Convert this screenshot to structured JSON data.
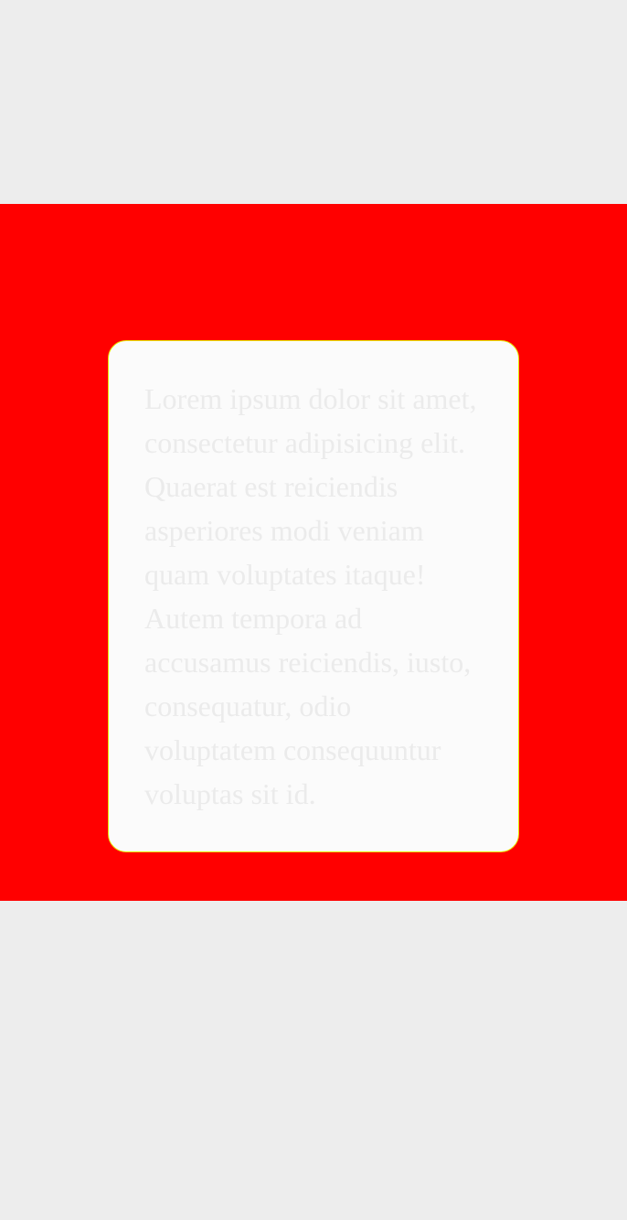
{
  "page": {
    "background_color": "#ededed",
    "band_color": "#ff0000",
    "card_background": "#fbfbfb",
    "card_border_color": "#e8e800",
    "text_color": "#ebebeb"
  },
  "card": {
    "text": "Lorem ipsum dolor sit amet, consectetur adipisicing elit. Quaerat est reiciendis asperiores modi veniam quam voluptates itaque! Autem tempora ad accusamus reiciendis, iusto, consequatur, odio voluptatem consequuntur voluptas sit id."
  }
}
